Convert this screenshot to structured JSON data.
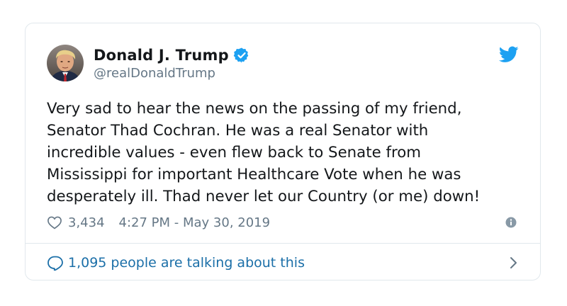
{
  "colors": {
    "name": "#14171a",
    "muted": "#657786",
    "link": "#1b6fa8",
    "brand": "#1da1f2",
    "border": "#e1e8ed"
  },
  "author": {
    "display_name": "Donald J. Trump",
    "handle": "@realDonaldTrump",
    "verified": true,
    "verified_icon": "verified-badge-icon",
    "avatar": "avatar"
  },
  "brand_icon": "twitter-bird-icon",
  "tweet": {
    "lines": [
      "Very sad to hear the news on the passing of my friend,",
      "Senator Thad Cochran. He was a real Senator with",
      "incredible values - even flew back to Senate from",
      "Mississippi for important Healthcare Vote when he was",
      "desperately ill. Thad never let our Country (or me) down!"
    ]
  },
  "meta": {
    "like_icon": "heart-icon",
    "like_count": "3,434",
    "timestamp": "4:27 PM - May 30, 2019",
    "info_icon": "info-icon"
  },
  "footer": {
    "icon": "chat-bubble-icon",
    "talking_text": "1,095 people are talking about this",
    "chevron_icon": "chevron-right-icon"
  }
}
